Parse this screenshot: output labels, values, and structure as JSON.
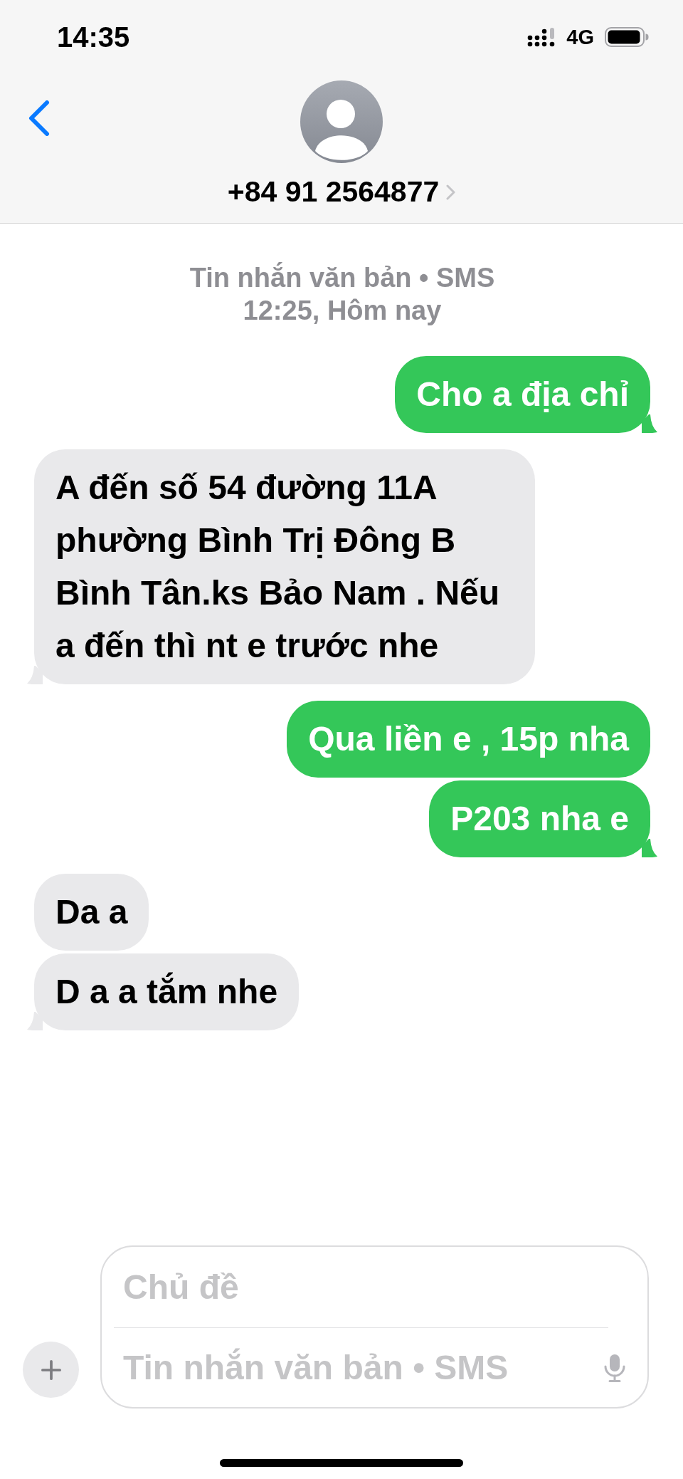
{
  "status_bar": {
    "time": "14:35",
    "network": "4G"
  },
  "header": {
    "contact": "+84 91 2564877"
  },
  "conversation": {
    "service": "Tin nhắn văn bản • SMS",
    "timestamp": "12:25, Hôm nay",
    "groups": [
      {
        "kind": "sent",
        "messages": [
          "Cho a địa chỉ"
        ]
      },
      {
        "kind": "received",
        "messages": [
          "A đến số 54 đường 11A phường Bình Trị Đông B Bình Tân.ks Bảo Nam . Nếu a đến thì nt e trước nhe"
        ]
      },
      {
        "kind": "sent",
        "messages": [
          "Qua liền e , 15p nha",
          "P203 nha e"
        ]
      },
      {
        "kind": "received",
        "messages": [
          "Da a",
          "D a a tắm nhe"
        ]
      }
    ]
  },
  "composer": {
    "subject_placeholder": "Chủ đề",
    "message_placeholder": "Tin nhắn văn bản • SMS"
  }
}
